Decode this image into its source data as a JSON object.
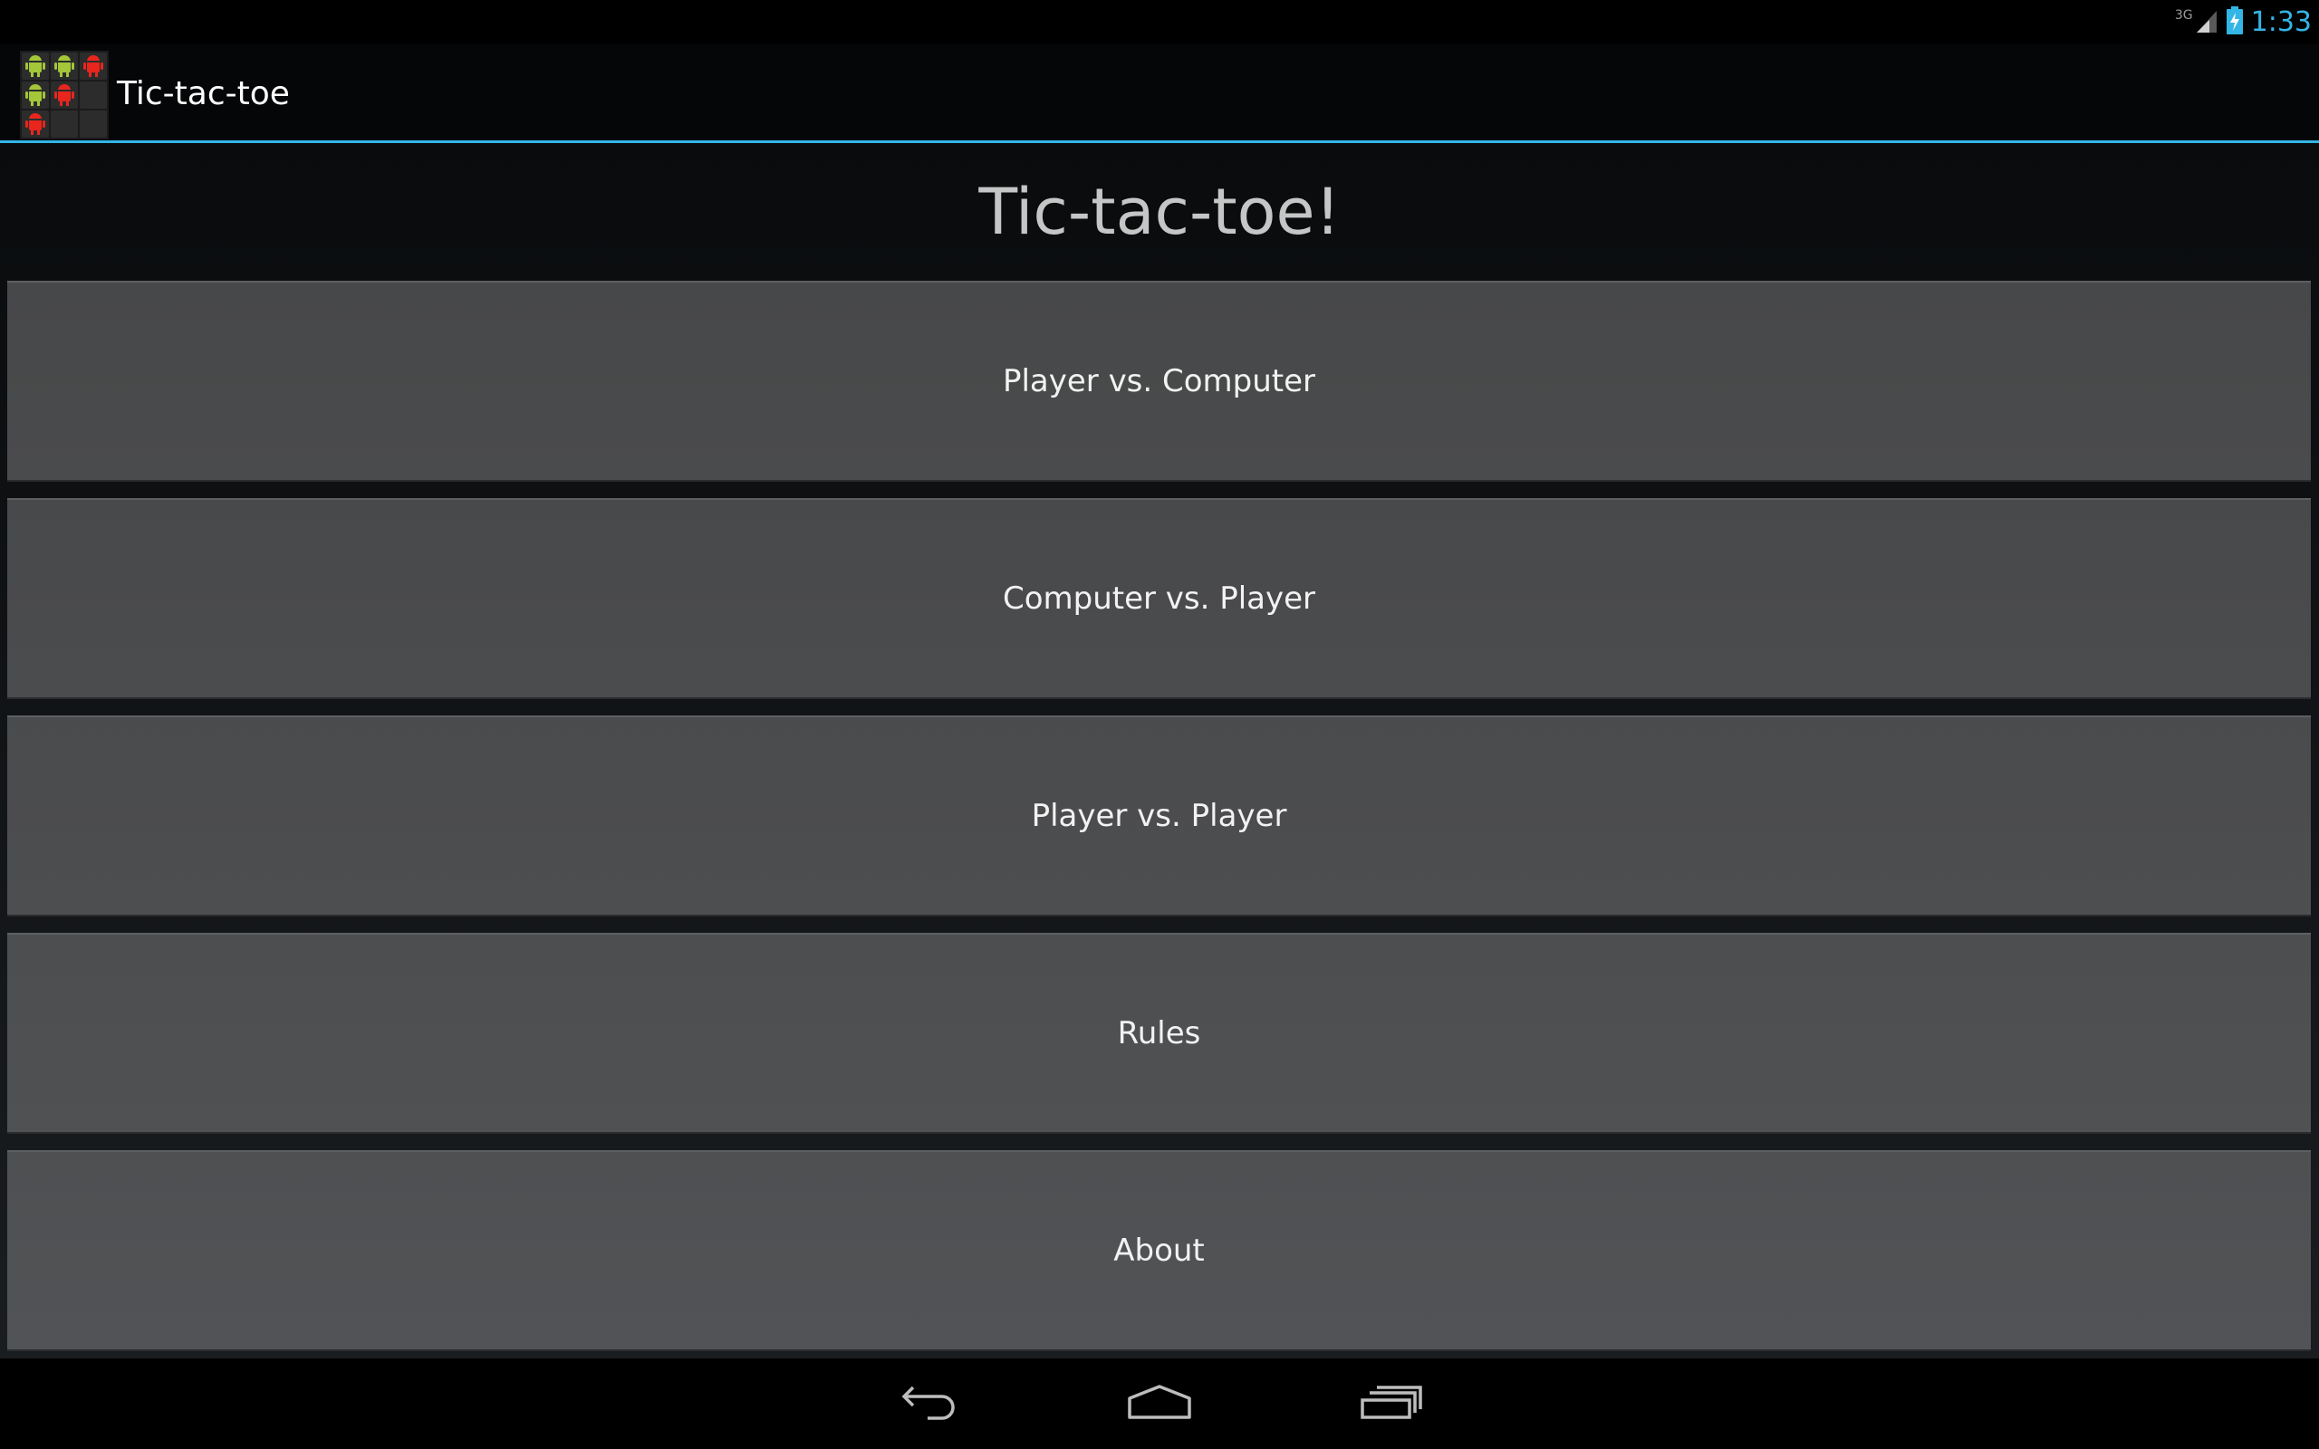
{
  "status_bar": {
    "network_type": "3G",
    "time": "1:33",
    "icons": [
      "signal-icon",
      "battery-charging-icon"
    ],
    "accent_color": "#33b5e5"
  },
  "action_bar": {
    "app_icon": "tic-tac-toe-grid-icon",
    "title": "Tic-tac-toe"
  },
  "main": {
    "heading": "Tic-tac-toe!",
    "buttons": [
      {
        "label": "Player vs. Computer"
      },
      {
        "label": "Computer vs. Player"
      },
      {
        "label": "Player vs. Player"
      },
      {
        "label": "Rules"
      },
      {
        "label": "About"
      }
    ]
  },
  "nav_bar": {
    "icons": [
      "back-icon",
      "home-icon",
      "recent-apps-icon"
    ]
  }
}
